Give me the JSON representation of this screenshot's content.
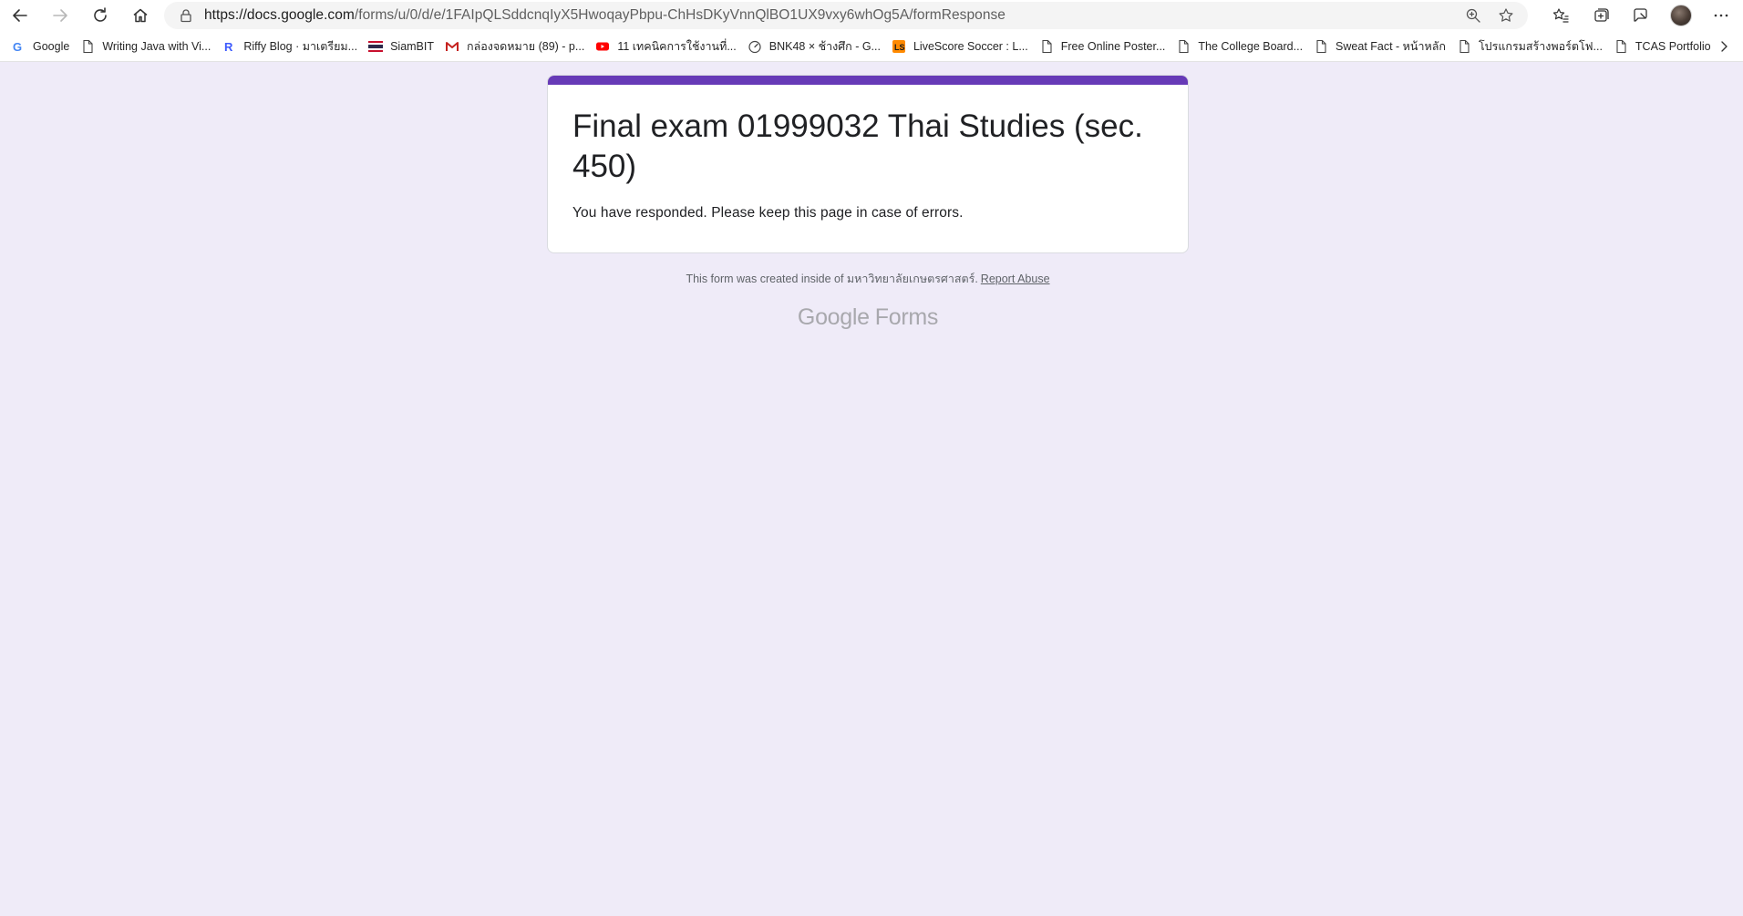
{
  "browser": {
    "address_host": "https://docs.google.com",
    "address_path": "/forms/u/0/d/e/1FAIpQLSddcnqIyX5HwoqayPbpu-ChHsDKyVnnQlBO1UX9vxy6whOg5A/formResponse"
  },
  "toolbar_icons": {
    "back": "back-arrow-icon",
    "forward": "forward-arrow-icon",
    "refresh": "refresh-icon",
    "home": "home-icon",
    "lock": "lock-icon",
    "zoom": "zoom-icon",
    "favorite": "star-icon",
    "favorites_list": "favorites-icon",
    "collections": "collections-icon",
    "feedback": "feedback-icon",
    "profile": "profile-avatar",
    "more": "more-icon"
  },
  "bookmarks": [
    {
      "label": "Google",
      "icon": "google-icon"
    },
    {
      "label": "Writing Java with Vi...",
      "icon": "page-icon"
    },
    {
      "label": "Riffy Blog · มาเตรียม...",
      "icon": "riffy-icon"
    },
    {
      "label": "SiamBIT",
      "icon": "thai-flag-icon"
    },
    {
      "label": "กล่องจดหมาย (89) - p...",
      "icon": "gmail-icon"
    },
    {
      "label": "11 เทคนิคการใช้งานที่...",
      "icon": "youtube-icon"
    },
    {
      "label": "BNK48 × ช้างศึก - G...",
      "icon": "speedometer-icon"
    },
    {
      "label": "LiveScore Soccer : L...",
      "icon": "livescore-icon"
    },
    {
      "label": "Free Online Poster...",
      "icon": "page-icon"
    },
    {
      "label": "The College Board...",
      "icon": "page-icon"
    },
    {
      "label": "Sweat Fact - หน้าหลัก",
      "icon": "page-icon"
    },
    {
      "label": "โปรแกรมสร้างพอร์ตโฟ...",
      "icon": "page-icon"
    },
    {
      "label": "TCAS Portfolio",
      "icon": "page-icon"
    }
  ],
  "form": {
    "title": "Final exam 01999032 Thai Studies (sec. 450)",
    "message": "You have responded. Please keep this page in case of errors.",
    "accent_color": "#673ab7",
    "background_color": "#efebf8"
  },
  "footer": {
    "note": "This form was created inside of มหาวิทยาลัยเกษตรศาสตร์.",
    "report_link": "Report Abuse",
    "logo_google": "Google",
    "logo_forms": "Forms"
  }
}
